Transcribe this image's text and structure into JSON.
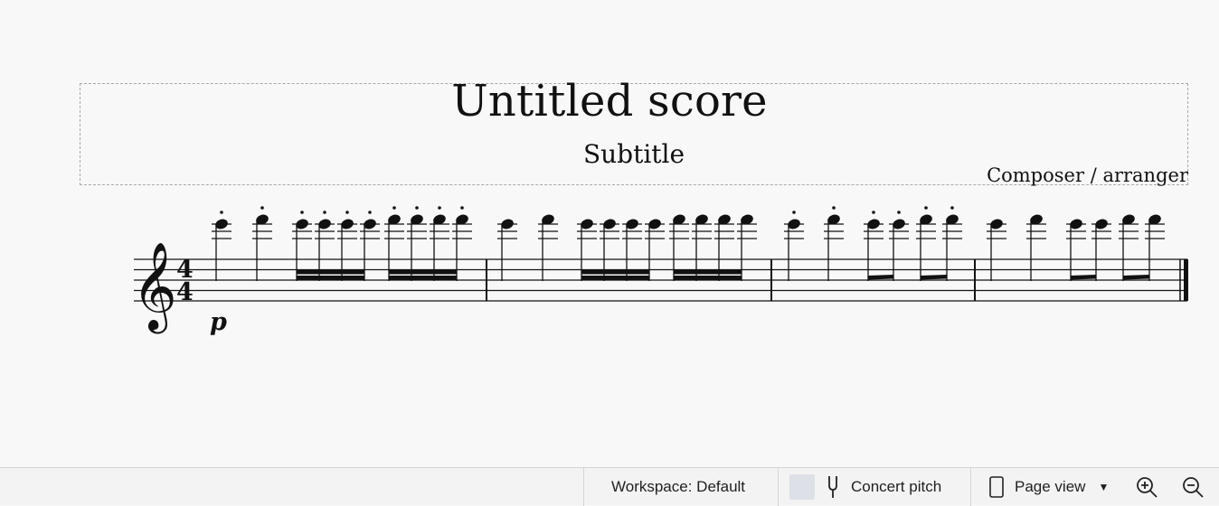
{
  "score": {
    "title": "Untitled score",
    "subtitle": "Subtitle",
    "composer": "Composer / arranger",
    "time_signature": {
      "top": "4",
      "bottom": "4"
    },
    "clef": "treble",
    "dynamic": "p"
  },
  "statusbar": {
    "workspace_label": "Workspace: Default",
    "concert_pitch_label": "Concert pitch",
    "concert_pitch_checked": false,
    "view_mode_label": "Page view",
    "icons": [
      "tuning-fork-icon",
      "page-icon",
      "chevron-down-icon",
      "zoom-in-icon",
      "zoom-out-icon"
    ]
  },
  "colors": {
    "canvas": "#f8f8f8",
    "statusbar": "#f3f3f3",
    "ink": "#111111"
  }
}
